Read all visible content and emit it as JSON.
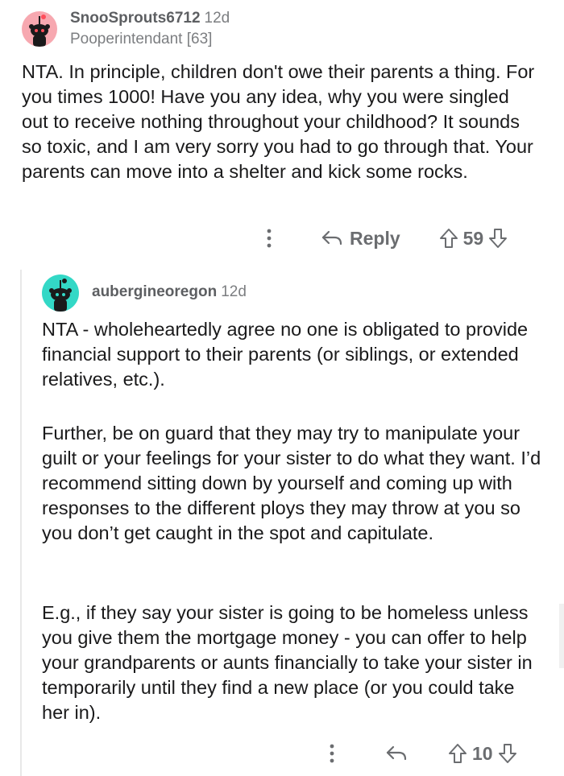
{
  "comments": [
    {
      "username": "SnooSprouts6712",
      "age": "12d",
      "flair": "Pooperintendant [63]",
      "paragraphs": [
        "NTA. In principle, children don't owe their parents a thing. For you times 1000! Have you any idea, why you were singled out to receive nothing throughout your childhood? It sounds so toxic, and I am very sorry you had to go through that. Your parents can move into a shelter and kick some rocks."
      ],
      "reply_label": "Reply",
      "score": "59"
    },
    {
      "username": "aubergineoregon",
      "age": "12d",
      "paragraphs": [
        "NTA - wholeheartedly agree no one is obligated to provide financial support to their parents (or siblings, or extended relatives, etc.).",
        "Further, be on guard that they may try to manipulate your guilt or your feelings for your sister to do what they want. I’d recommend sitting down by yourself and coming up with responses to the different ploys they may throw at you so you don’t get caught in the spot and capitulate.",
        "E.g., if they say your sister is going to be homeless unless you give them the mortgage money - you can offer to help your grandparents or aunts financially to take your sister in temporarily until they find a new place (or you could take her in)."
      ],
      "score": "10"
    }
  ],
  "colors": {
    "avatar_1": "#f7a8b0",
    "avatar_2": "#33d8c6",
    "meta_text": "#7c7e81",
    "body_text": "#1a1a1b"
  },
  "icons": [
    "snoo-avatar-icon",
    "more-options-icon",
    "reply-arrow-icon",
    "upvote-arrow-icon",
    "downvote-arrow-icon"
  ]
}
